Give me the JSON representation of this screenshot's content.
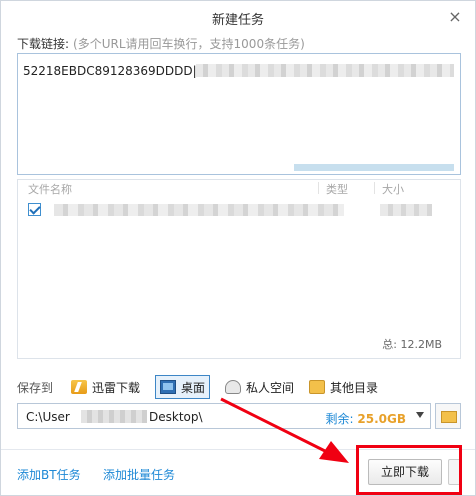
{
  "window": {
    "title": "新建任务",
    "close_glyph": "×"
  },
  "link_field": {
    "label": "下载链接:",
    "hint": "(多个URL请用回车换行，支持1000条任务)",
    "value": "52218EBDC89128369DDDD|h"
  },
  "files": {
    "col_name": "文件名称",
    "col_type": "类型",
    "col_size": "大小",
    "total": "总: 12.2MB"
  },
  "save": {
    "label": "保存到",
    "locations": [
      "迅雷下载",
      "桌面",
      "私人空间",
      "其他目录"
    ],
    "selected": "桌面",
    "path_prefix": "C:\\User",
    "path_suffix": "Desktop\\",
    "free_label": "剩余:",
    "free_value": "25.0GB"
  },
  "footer": {
    "add_bt": "添加BT任务",
    "add_batch": "添加批量任务",
    "download_now": "立即下载"
  },
  "colors": {
    "annotation_red": "#f00012",
    "link_blue": "#1e89d6",
    "free_orange": "#e8a12a"
  }
}
